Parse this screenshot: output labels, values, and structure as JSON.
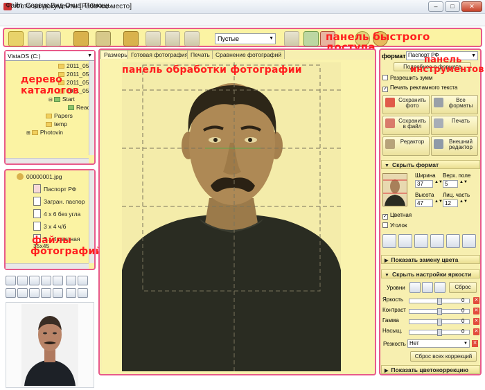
{
  "window": {
    "title": "Фото на документы  [Рабочее место]",
    "min": "–",
    "max": "□",
    "close": "✕"
  },
  "menu": [
    "Файл",
    "Сервис",
    "Вид",
    "Окна",
    "Помощь"
  ],
  "toolbar": {
    "preset_value": "Пустые",
    "overlay_label": "панель быстрого доступа"
  },
  "tree": {
    "drive": "VistaOS (C:)",
    "items": [
      "2011_05_",
      "2011_05_",
      "2011_05_",
      "2011_05_",
      "Start",
      "Ready",
      "Papers",
      "temp",
      "Photovin"
    ],
    "overlay_label_1": "дерево",
    "overlay_label_2": "каталогов"
  },
  "files": {
    "root": "00000001.jpg",
    "items": [
      "Паспорт РФ",
      "Загран. паспор",
      "4 x 6 без угла",
      "3 x 4 ч/б",
      "3 x 4 цветная",
      "35x45"
    ],
    "overlay_label_1": "файлы",
    "overlay_label_2": "фотографий"
  },
  "tabs": [
    "Размеры",
    "Готовая фотография",
    "Печать",
    "Сравнение фотографий"
  ],
  "center": {
    "overlay_label": "панель обработки фотографии"
  },
  "right": {
    "overlay_label_1": "панель",
    "overlay_label_2": "инструментов",
    "format_label": "формат",
    "format_value": "Паспорт РФ",
    "format_details": "Подробнее о формате",
    "allow_zoom": "Разрешить зумм",
    "print_ad": "Печать рекламного текста",
    "btn_save_photo": "Сохранить фото",
    "btn_all_formats": "Все форматы",
    "btn_save_file": "Сохранить в файл",
    "btn_print": "Печать",
    "btn_editor": "Редактор",
    "btn_ext_editor": "Внешний редактор",
    "hide_format": "Скрыть формат",
    "width_label": "Ширина",
    "width_value": "37",
    "top_margin_label": "Верх. поле",
    "top_margin_value": "5",
    "height_label": "Высота",
    "height_value": "47",
    "face_label": "Лиц. часть",
    "face_value": "12",
    "color_label": "Цветная",
    "corner_label": "Уголок",
    "show_color_replace": "Показать замену цвета",
    "hide_brightness": "Скрыть настройки яркости",
    "levels_label": "Уровни",
    "reset_label": "Сброс",
    "adjustments": [
      {
        "label": "Яркость",
        "value": "0"
      },
      {
        "label": "Контраст",
        "value": "0"
      },
      {
        "label": "Гамма",
        "value": "0"
      },
      {
        "label": "Насыщ.",
        "value": "0"
      }
    ],
    "sharpness_label": "Резкость",
    "sharpness_value": "Нет",
    "reset_all": "Сброс всех коррекций",
    "show_color_correction": "Показать цветокоррекцию"
  },
  "colors": {
    "panel_yellow": "#fbf3a3",
    "highlight_border": "#e85a8a",
    "overlay_text": "#ff1e1e"
  }
}
